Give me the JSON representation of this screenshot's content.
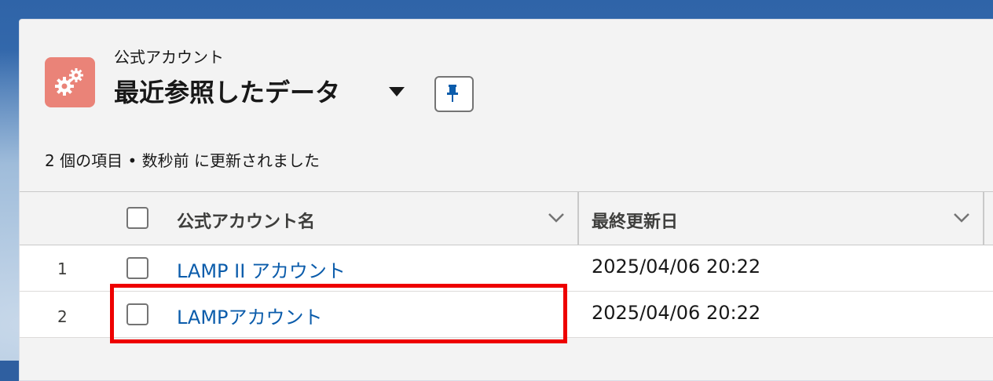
{
  "header": {
    "object_label": "公式アカウント",
    "view_title": "最近参照したデータ",
    "icon": "gears-icon",
    "pin_icon": "pin-icon"
  },
  "status": "2 個の項目 • 数秒前 に更新されました",
  "table": {
    "columns": [
      "公式アカウント名",
      "最終更新日"
    ],
    "rows": [
      {
        "num": "1",
        "name": "LAMP II アカウント",
        "date": "2025/04/06 20:22"
      },
      {
        "num": "2",
        "name": "LAMPアカウント",
        "date": "2025/04/06 20:22"
      }
    ]
  },
  "colors": {
    "icon_bg": "#ea8378",
    "link": "#0b5cab",
    "highlight": "#ee0000"
  }
}
